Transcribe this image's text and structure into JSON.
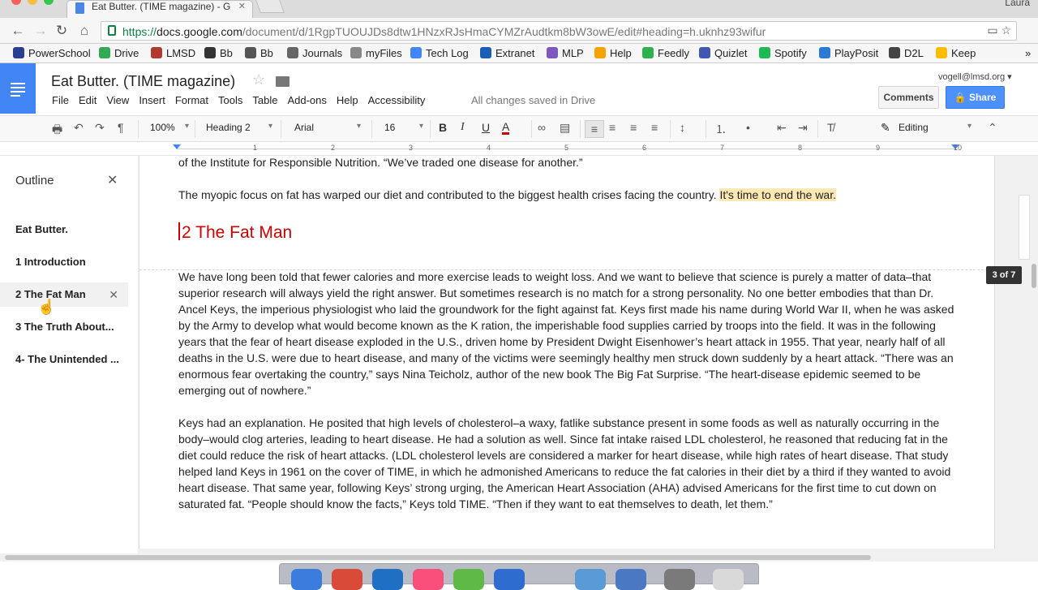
{
  "browser": {
    "tab_title": "Eat Butter. (TIME magazine) - G",
    "tab_close": "✕",
    "user": "Laura",
    "url_secure": "https://",
    "url_domain": "docs.google.com",
    "url_path": "/document/d/1RgpTUOUJDs8dtw1HNzxRJsHmaCYMZrAudtkm8bW3owE/edit#heading=h.uknhz93wifur",
    "url_right_icons": "▭ ☆",
    "nav_back": "←",
    "nav_forward": "→",
    "nav_reload": "↻",
    "nav_home": "⌂",
    "bookmarks_more": "»",
    "bookmarks": [
      {
        "label": "PowerSchool",
        "color": "#2a3f8f"
      },
      {
        "label": "Drive",
        "color": "#34a853"
      },
      {
        "label": "LMSD",
        "color": "#b03a2e"
      },
      {
        "label": "Bb",
        "color": "#333333"
      },
      {
        "label": "Bb",
        "color": "#555555"
      },
      {
        "label": "Journals",
        "color": "#666666"
      },
      {
        "label": "myFiles",
        "color": "#888888"
      },
      {
        "label": "Tech Log",
        "color": "#4285f4"
      },
      {
        "label": "Extranet",
        "color": "#1a5fb4"
      },
      {
        "label": "MLP",
        "color": "#7e57c2"
      },
      {
        "label": "Help",
        "color": "#f4a300"
      },
      {
        "label": "Feedly",
        "color": "#2bb24c"
      },
      {
        "label": "Quizlet",
        "color": "#4257b2"
      },
      {
        "label": "Spotify",
        "color": "#1db954"
      },
      {
        "label": "PlayPosit",
        "color": "#2b7bd6"
      },
      {
        "label": "D2L",
        "color": "#444444"
      },
      {
        "label": "Keep",
        "color": "#fbbc04"
      }
    ]
  },
  "doc": {
    "title": "Eat Butter. (TIME magazine)",
    "menus": [
      "File",
      "Edit",
      "View",
      "Insert",
      "Format",
      "Tools",
      "Table",
      "Add-ons",
      "Help",
      "Accessibility"
    ],
    "saved_status": "All changes saved in Drive",
    "account": "vogell@lmsd.org ▾",
    "comments_label": "Comments",
    "share_label": "Share",
    "star": "☆"
  },
  "toolbar": {
    "zoom": "100%",
    "style": "Heading 2",
    "font": "Arial",
    "size": "16",
    "bold": "B",
    "italic": "I",
    "underline": "U",
    "text_color": "A",
    "mode": "Editing",
    "print": "🖶",
    "undo": "↶",
    "redo": "↷",
    "paint": "¶",
    "link": "∞",
    "comment": "▤",
    "align_left": "≡",
    "align_center": "≡",
    "align_right": "≡",
    "justify": "≡",
    "line_spacing": "↕",
    "numbered_list": "⒈",
    "bulleted_list": "•",
    "decrease_indent": "⇤",
    "increase_indent": "⇥",
    "clear_format": "T̸",
    "collapse": "⌃",
    "mode_icon": "✎"
  },
  "ruler": {
    "numbers": [
      "1",
      "2",
      "3",
      "4",
      "5",
      "6",
      "7",
      "8",
      "9",
      "10"
    ]
  },
  "outline": {
    "header": "Outline",
    "close": "✕",
    "items": [
      {
        "label": "Eat Butter."
      },
      {
        "label": "1 Introduction"
      },
      {
        "label": "2  The Fat Man"
      },
      {
        "label": "3  The Truth About..."
      },
      {
        "label": "4- The Unintended ..."
      }
    ],
    "item_close": "✕"
  },
  "content": {
    "para0": "of the Institute for Responsible Nutrition. “We’ve traded one disease for another.”",
    "para1_plain": "The myopic focus on fat has warped our diet and contributed to the biggest health crises facing the country. ",
    "para1_highlight": "It's time to end the war.",
    "heading": "2  The Fat Man",
    "para2": "We have long been told that fewer calories and more exercise leads to weight loss. And we want to believe that science is purely a matter of data–that superior research will always yield the right answer. But sometimes research is no match for a strong personality. No one better embodies that than Dr. Ancel Keys, the imperious physiologist who laid the groundwork for the fight against fat. Keys first made his name during World War II, when he was asked by the Army to develop what would become known as the K ration, the imperishable food supplies carried by troops into the field. It was in the following years that the fear of heart disease exploded in the U.S., driven home by President Dwight Eisenhower’s heart attack in 1955. That year, nearly half of all deaths in the U.S. were due to heart disease, and many of the victims were seemingly healthy men struck down suddenly by a heart attack. “There was an enormous fear overtaking the country,” says Nina Teicholz, author of the new book The Big Fat Surprise. “The heart-disease epidemic seemed to be emerging out of nowhere.”",
    "para3": "Keys had an explanation. He posited that high levels of cholesterol–a waxy, fatlike substance present in some foods as well as naturally occurring in the body–would clog arteries, leading to heart disease. He had a solution as well. Since fat intake raised LDL cholesterol, he reasoned that reducing fat in the diet could reduce the risk of heart attacks. (LDL cholesterol levels are considered a marker for heart disease, while high  rates of heart disease. That study helped land Keys in 1961 on the cover of TIME, in which he admonished Americans to reduce the fat calories in their diet by a third if they wanted to avoid heart disease. That same year, following Keys’ strong urging, the American Heart Association (AHA) advised Americans for the first time to cut down on saturated fat. “People should know the facts,” Keys told TIME. “Then if they want to eat themselves to death, let them.”",
    "page_badge": "3 of 7"
  },
  "colors": {
    "heading": "#cc0000",
    "highlight": "#fce8b2",
    "share": "#4d90fe",
    "docs_blue": "#4285f4"
  }
}
